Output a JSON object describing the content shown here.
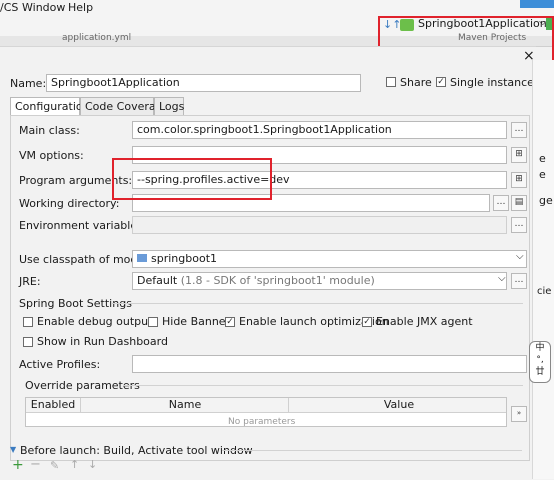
{
  "menu": {
    "vcs": "/CS",
    "window": "Window",
    "help": "Help"
  },
  "toolbar": {
    "run_config": "Springboot1Application"
  },
  "editor": {
    "tab_label": "application.yml",
    "maven_label": "Maven Projects"
  },
  "right_strip": {
    "l1": "e",
    "l2": "e",
    "l3": "ge",
    "l4": "cie"
  },
  "dialog": {
    "name_label": "Name:",
    "name_value": "Springboot1Application",
    "share_label": "Share",
    "single_instance_label": "Single instance only",
    "tabs": [
      "Configuration",
      "Code Coverage",
      "Logs"
    ],
    "main_class_label": "Main class:",
    "main_class_value": "com.color.springboot1.Springboot1Application",
    "vm_options_label": "VM options:",
    "vm_options_value": "",
    "program_args_label": "Program arguments:",
    "program_args_value": "--spring.profiles.active=dev",
    "working_dir_label": "Working directory:",
    "working_dir_value": "",
    "env_vars_label": "Environment variables:",
    "env_vars_value": "",
    "classpath_label": "Use classpath of module:",
    "classpath_value": "springboot1",
    "jre_label": "JRE:",
    "jre_value": "Default",
    "jre_detail": "(1.8 - SDK of 'springboot1' module)",
    "spring_boot_settings": "Spring Boot Settings",
    "enable_debug_output": "Enable debug output",
    "hide_banner": "Hide Banner",
    "enable_launch_optimization": "Enable launch optimization",
    "enable_jmx_agent": "Enable JMX agent",
    "show_in_run_dashboard": "Show in Run Dashboard",
    "active_profiles_label": "Active Profiles:",
    "active_profiles_value": "",
    "override_parameters": "Override parameters",
    "table_headers": [
      "Enabled",
      "Name",
      "Value"
    ],
    "table_empty": "No parameters",
    "before_launch": "Before launch: Build, Activate tool window",
    "checkboxes": {
      "share": false,
      "single_instance": true,
      "debug": false,
      "hide_banner": false,
      "launch_opt": true,
      "jmx": true,
      "dashboard": false
    }
  },
  "ime": {
    "char1": "中",
    "char2": "°,",
    "char3": "廿"
  },
  "colors": {
    "accent_highlight": "#e0222c",
    "run_icon": "#4caf50"
  }
}
